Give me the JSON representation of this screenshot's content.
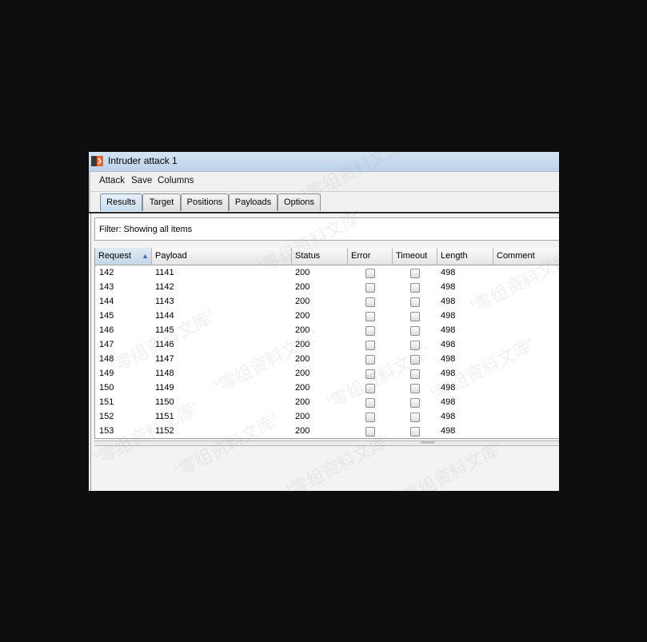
{
  "window": {
    "title": "Intruder attack 1",
    "app_icon": "burp-intruder-icon"
  },
  "menu": [
    "Attack",
    "Save",
    "Columns"
  ],
  "tabs": [
    {
      "label": "Results",
      "active": true
    },
    {
      "label": "Target",
      "active": false
    },
    {
      "label": "Positions",
      "active": false
    },
    {
      "label": "Payloads",
      "active": false
    },
    {
      "label": "Options",
      "active": false
    }
  ],
  "filter": {
    "text": "Filter:  Showing all items"
  },
  "table": {
    "columns": [
      "Request",
      "Payload",
      "Status",
      "Error",
      "Timeout",
      "Length",
      "Comment"
    ],
    "sorted_column": "Request",
    "sort_direction": "ascending",
    "rows": [
      {
        "request": "142",
        "payload": "1141",
        "status": "200",
        "error": false,
        "timeout": false,
        "length": "498",
        "comment": ""
      },
      {
        "request": "143",
        "payload": "1142",
        "status": "200",
        "error": false,
        "timeout": false,
        "length": "498",
        "comment": ""
      },
      {
        "request": "144",
        "payload": "1143",
        "status": "200",
        "error": false,
        "timeout": false,
        "length": "498",
        "comment": ""
      },
      {
        "request": "145",
        "payload": "1144",
        "status": "200",
        "error": false,
        "timeout": false,
        "length": "498",
        "comment": ""
      },
      {
        "request": "146",
        "payload": "1145",
        "status": "200",
        "error": false,
        "timeout": false,
        "length": "498",
        "comment": ""
      },
      {
        "request": "147",
        "payload": "1146",
        "status": "200",
        "error": false,
        "timeout": false,
        "length": "498",
        "comment": ""
      },
      {
        "request": "148",
        "payload": "1147",
        "status": "200",
        "error": false,
        "timeout": false,
        "length": "498",
        "comment": ""
      },
      {
        "request": "149",
        "payload": "1148",
        "status": "200",
        "error": false,
        "timeout": false,
        "length": "498",
        "comment": ""
      },
      {
        "request": "150",
        "payload": "1149",
        "status": "200",
        "error": false,
        "timeout": false,
        "length": "498",
        "comment": ""
      },
      {
        "request": "151",
        "payload": "1150",
        "status": "200",
        "error": false,
        "timeout": false,
        "length": "498",
        "comment": ""
      },
      {
        "request": "152",
        "payload": "1151",
        "status": "200",
        "error": false,
        "timeout": false,
        "length": "498",
        "comment": ""
      },
      {
        "request": "153",
        "payload": "1152",
        "status": "200",
        "error": false,
        "timeout": false,
        "length": "498",
        "comment": ""
      }
    ]
  },
  "watermark_text": "'零组资料文库'",
  "colors": {
    "titlebar": "#c9dcf0",
    "active_tab": "#d3e4f3",
    "sort_arrow": "#3f6fa0"
  }
}
